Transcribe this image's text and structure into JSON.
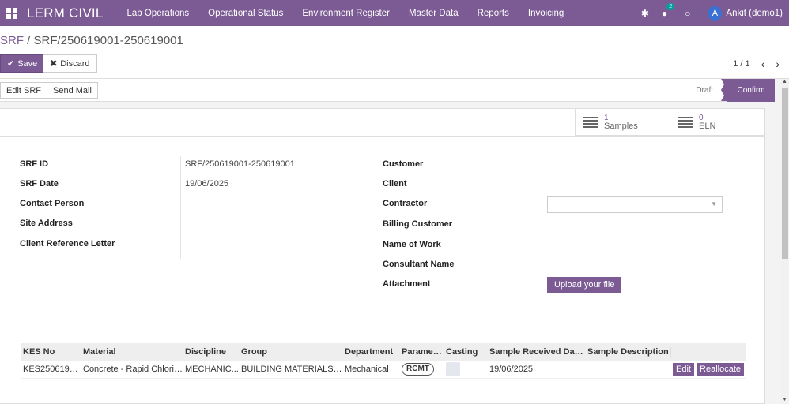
{
  "navbar": {
    "brand": "LERM CIVIL",
    "menu": [
      "Lab Operations",
      "Operational Status",
      "Environment Register",
      "Master Data",
      "Reports",
      "Invoicing"
    ],
    "chat_badge": "2",
    "avatar_initial": "A",
    "username": "Ankit (demo1)"
  },
  "breadcrumb": {
    "parent": "SRF",
    "separator": "/",
    "current": "SRF/250619001-250619001"
  },
  "buttons": {
    "save": "Save",
    "discard": "Discard"
  },
  "pager": {
    "value": "1 / 1",
    "prev": "‹",
    "next": "›"
  },
  "statusbar": {
    "edit_srf": "Edit SRF",
    "send_mail": "Send Mail",
    "stages": [
      "Draft",
      "Confirm"
    ],
    "active_stage": "Confirm"
  },
  "smart_buttons": [
    {
      "value": "1",
      "label": "Samples"
    },
    {
      "value": "0",
      "label": "ELN"
    }
  ],
  "left_fields": [
    {
      "label": "SRF ID",
      "value": "SRF/250619001-250619001"
    },
    {
      "label": "SRF Date",
      "value": "19/06/2025"
    },
    {
      "label": "Contact Person",
      "value": ""
    },
    {
      "label": "Site Address",
      "value": ""
    },
    {
      "label": "Client Reference Letter",
      "value": ""
    }
  ],
  "right_fields": [
    {
      "label": "Customer"
    },
    {
      "label": "Client"
    },
    {
      "label": "Contractor"
    },
    {
      "label": "Billing Customer"
    },
    {
      "label": "Name of Work"
    },
    {
      "label": "Consultant Name"
    },
    {
      "label": "Attachment"
    }
  ],
  "upload_label": "Upload your file",
  "table": {
    "headers": [
      "KES No",
      "Material",
      "Discipline",
      "Group",
      "Department",
      "Parameter",
      "Casting",
      "Sample Received Date...",
      "Sample Description",
      ""
    ],
    "rows": [
      {
        "kes_no": "KES2506190...",
        "material": "Concrete - Rapid Chlorid...",
        "discipline": "MECHANIC...",
        "group": "BUILDING MATERIALS -...",
        "department": "Mechanical",
        "parameter": "RCMT",
        "received_date": "19/06/2025",
        "description": "",
        "edit": "Edit",
        "reallocate": "Reallocate"
      }
    ]
  },
  "colors": {
    "primary": "#7c5b94",
    "badge": "#00a09d",
    "avatar": "#3b6fd1"
  }
}
